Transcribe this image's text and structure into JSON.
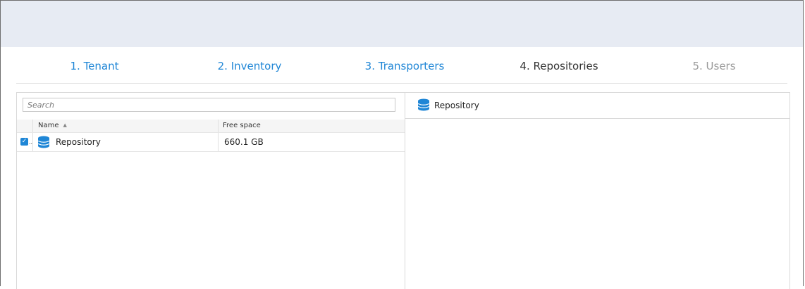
{
  "wizard": {
    "steps": [
      {
        "label": "1. Tenant",
        "state": "link"
      },
      {
        "label": "2. Inventory",
        "state": "link"
      },
      {
        "label": "3. Transporters",
        "state": "link"
      },
      {
        "label": "4. Repositories",
        "state": "current"
      },
      {
        "label": "5. Users",
        "state": "disabled"
      }
    ]
  },
  "left_pane": {
    "search_placeholder": "Search",
    "columns": {
      "name": "Name",
      "free_space": "Free space"
    },
    "rows": [
      {
        "checked": true,
        "icon": "database-icon",
        "name": "Repository",
        "free_space": "660.1 GB"
      }
    ]
  },
  "right_pane": {
    "icon": "database-icon",
    "title": "Repository"
  },
  "colors": {
    "accent": "#1f86d6",
    "topbar": "#e7ebf3",
    "disabled": "#9a9a9a"
  }
}
